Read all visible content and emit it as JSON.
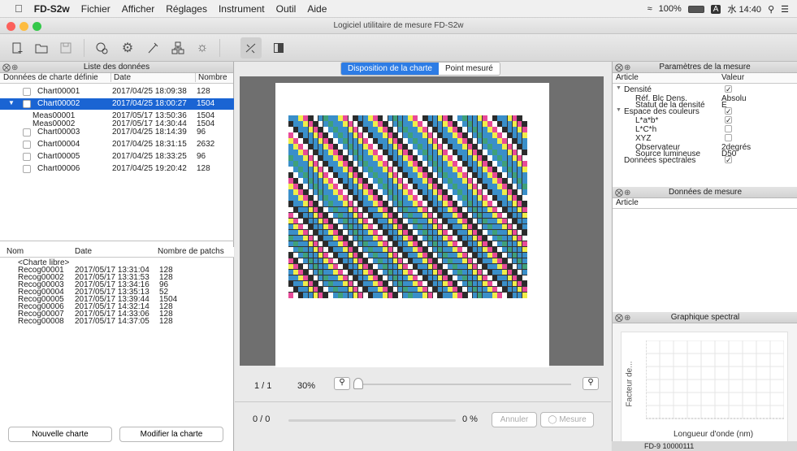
{
  "menubar": {
    "app_name": "FD-S2w",
    "items": [
      "Fichier",
      "Afficher",
      "Réglages",
      "Instrument",
      "Outil",
      "Aide"
    ],
    "battery": "100%",
    "input": "A",
    "clock": "水 14:40"
  },
  "window": {
    "title": "Logiciel utilitaire de mesure FD-S2w"
  },
  "toolbar": {
    "icons": [
      "new-file-icon",
      "open-folder-icon",
      "save-icon",
      "color-settings-icon",
      "gear-icon",
      "measure-settings-icon",
      "layout-icon",
      "brightness-icon",
      "scatter-icon",
      "panel-icon"
    ]
  },
  "data_list": {
    "title": "Liste des données",
    "columns": [
      "Données de charte définie",
      "Date",
      "Nombre"
    ],
    "rows": [
      {
        "name": "Chart00001",
        "date": "2017/04/25 18:09:38",
        "count": "128",
        "level": 0,
        "selected": false
      },
      {
        "name": "Chart00002",
        "date": "2017/04/25 18:00:27",
        "count": "1504",
        "level": 0,
        "selected": true,
        "expanded": true
      },
      {
        "name": "Meas00001",
        "date": "2017/05/17 13:50:36",
        "count": "1504",
        "level": 1,
        "selected": false
      },
      {
        "name": "Meas00002",
        "date": "2017/05/17 14:30:44",
        "count": "1504",
        "level": 1,
        "selected": false
      },
      {
        "name": "Chart00003",
        "date": "2017/04/25 18:14:39",
        "count": "96",
        "level": 0,
        "selected": false
      },
      {
        "name": "Chart00004",
        "date": "2017/04/25 18:31:15",
        "count": "2632",
        "level": 0,
        "selected": false
      },
      {
        "name": "Chart00005",
        "date": "2017/04/25 18:33:25",
        "count": "96",
        "level": 0,
        "selected": false
      },
      {
        "name": "Chart00006",
        "date": "2017/04/25 19:20:42",
        "count": "128",
        "level": 0,
        "selected": false
      }
    ]
  },
  "recog_list": {
    "columns": [
      "Nom",
      "Date",
      "Nombre de patchs"
    ],
    "free_label": "<Charte libre>",
    "rows": [
      {
        "name": "Recog00001",
        "date": "2017/05/17 13:31:04",
        "count": "128"
      },
      {
        "name": "Recog00002",
        "date": "2017/05/17 13:31:53",
        "count": "128"
      },
      {
        "name": "Recog00003",
        "date": "2017/05/17 13:34:16",
        "count": "96"
      },
      {
        "name": "Recog00004",
        "date": "2017/05/17 13:35:13",
        "count": "52"
      },
      {
        "name": "Recog00005",
        "date": "2017/05/17 13:39:44",
        "count": "1504"
      },
      {
        "name": "Recog00006",
        "date": "2017/05/17 14:32:14",
        "count": "128"
      },
      {
        "name": "Recog00007",
        "date": "2017/05/17 14:33:06",
        "count": "128"
      },
      {
        "name": "Recog00008",
        "date": "2017/05/17 14:37:05",
        "count": "128"
      }
    ]
  },
  "buttons": {
    "new_chart": "Nouvelle charte",
    "edit_chart": "Modifier la charte",
    "cancel": "Annuler",
    "measure": "Mesure"
  },
  "center": {
    "tabs": [
      "Disposition de la charte",
      "Point mesuré"
    ],
    "active_tab": 0,
    "page": "1 / 1",
    "zoom": "30%",
    "progress_count": "0 / 0",
    "progress_pct": "0 %"
  },
  "params": {
    "title": "Paramètres de la mesure",
    "columns": [
      "Article",
      "Valeur"
    ],
    "rows": [
      {
        "label": "Densité",
        "value": "check",
        "indent": 0,
        "arrow": true
      },
      {
        "label": "Réf. Blc Dens.",
        "value": "Absolu",
        "indent": 2
      },
      {
        "label": "Statut de la densité",
        "value": "E",
        "indent": 2
      },
      {
        "label": "Espace des couleurs",
        "value": "check",
        "indent": 0,
        "arrow": true
      },
      {
        "label": "L*a*b*",
        "value": "check",
        "indent": 2
      },
      {
        "label": "L*C*h",
        "value": "uncheck",
        "indent": 2
      },
      {
        "label": "XYZ",
        "value": "uncheck",
        "indent": 2
      },
      {
        "label": "Observateur",
        "value": "2degrés",
        "indent": 2
      },
      {
        "label": "Source lumineuse",
        "value": "D50",
        "indent": 2
      },
      {
        "label": "Données spectrales",
        "value": "check",
        "indent": 0
      }
    ]
  },
  "meas_data": {
    "title": "Données de mesure",
    "column": "Article"
  },
  "spectral": {
    "title": "Graphique spectral",
    "ylabel": "Facteur de...",
    "xlabel": "Longueur d'onde (nm)"
  },
  "status": {
    "serial": "FD-9 10000111"
  },
  "colors": {
    "accent": "#1a64d3",
    "patches": [
      "#3a8fc9",
      "#f0ed4a",
      "#e84a98",
      "#2b2b2b",
      "#ffffff",
      "#3fa07a"
    ]
  }
}
